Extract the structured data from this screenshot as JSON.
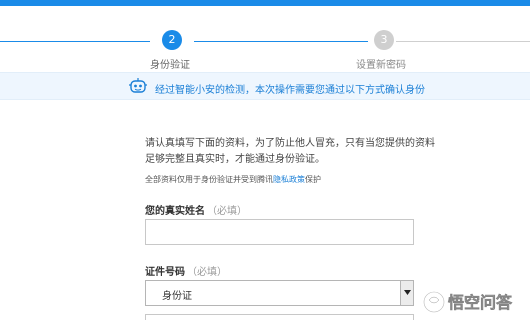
{
  "progress": {
    "steps": [
      {
        "number": "2",
        "label": "身份验证",
        "state": "active"
      },
      {
        "number": "3",
        "label": "设置新密码",
        "state": "pending"
      }
    ],
    "active_color": "#1a8be8",
    "pending_color": "#cfcfcf"
  },
  "notice": {
    "icon": "robot-icon",
    "text": "经过智能小安的检测，本次操作需要您通过以下方式确认身份"
  },
  "form": {
    "intro": "请认真填写下面的资料，为了防止他人冒充，只有当您提供的资料足够完整且真实时，才能通过身份验证。",
    "privacy_note_prefix": "全部资料仅用于身份验证并受到腾讯",
    "privacy_link": "隐私政策",
    "privacy_note_suffix": "保护",
    "name_label": "您的真实姓名",
    "name_hint": "（必填）",
    "name_value": "",
    "id_type_label": "证件号码",
    "id_type_hint": "（必填）",
    "id_type_selected": "身份证"
  },
  "watermark": {
    "text": "悟空问答"
  }
}
